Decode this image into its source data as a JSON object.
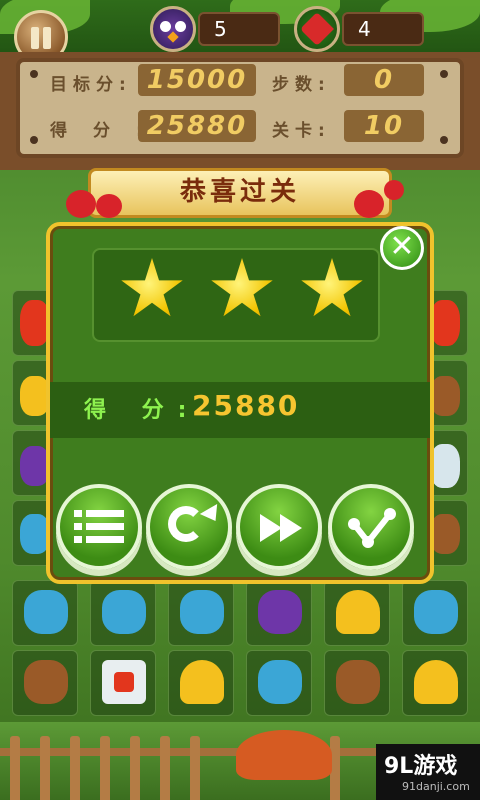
{
  "top": {
    "moves_label_icon": "owl-icon",
    "lives_icon": "broken-heart-icon",
    "owl_count": "5",
    "heart_count": "4"
  },
  "stats": {
    "target_label": "目标分:",
    "target_value": "15000",
    "steps_label": "步数:",
    "steps_value": "0",
    "score_label": "得分:",
    "score_value": "25880",
    "level_label": "关卡:",
    "level_value": "10"
  },
  "dialog": {
    "title": "恭喜过关",
    "stars": 3,
    "score_label": "得 分:",
    "score_value": "25880",
    "buttons": [
      {
        "icon": "menu-list-icon"
      },
      {
        "icon": "replay-icon"
      },
      {
        "icon": "next-icon"
      },
      {
        "icon": "share-icon"
      }
    ]
  },
  "watermark": {
    "brand": "9L游戏",
    "url": "91danji.com"
  },
  "colors": {
    "accent": "#f0c32c",
    "panel": "#3f7d1e",
    "score": "#f6c530"
  }
}
